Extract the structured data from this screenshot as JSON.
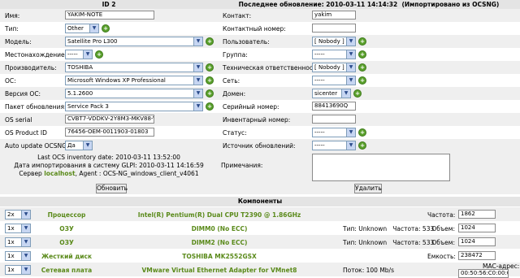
{
  "header": {
    "id_label": "ID 2",
    "last_update": "Последнее обновление: 2010-03-11 14:14:32",
    "imported": "(Импортировано из OCSNG)"
  },
  "left_fields": [
    {
      "label": "Имя:",
      "value": "YAKIM-NOTE",
      "kind": "input"
    },
    {
      "label": "Тип:",
      "value": "Other",
      "kind": "select",
      "plus": true
    },
    {
      "label": "Модель:",
      "value": "Satellite Pro L300",
      "kind": "select",
      "plus": true
    },
    {
      "label": "Местонахождение:",
      "value": "-----",
      "kind": "select",
      "plus": true
    },
    {
      "label": "Производитель:",
      "value": "TOSHIBA",
      "kind": "select",
      "plus": true
    },
    {
      "label": "ОС:",
      "value": "Microsoft Windows XP Professional",
      "kind": "select",
      "plus": true
    },
    {
      "label": "Версия ОС:",
      "value": "5.1.2600",
      "kind": "select",
      "plus": true
    },
    {
      "label": "Пакет обновления:",
      "value": "Service Pack 3",
      "kind": "select",
      "plus": true
    },
    {
      "label": "OS serial",
      "value": "CVBT7-VDDKV-2Y8M3-MKV88-V88B8",
      "kind": "input"
    },
    {
      "label": "OS Product ID",
      "value": "76456-OEM-0011903-01803",
      "kind": "input"
    },
    {
      "label": "Auto update OCSNG:",
      "value": "Да",
      "kind": "select"
    }
  ],
  "right_fields": [
    {
      "label": "Контакт:",
      "value": "yakim",
      "kind": "input"
    },
    {
      "label": "Контактный номер:",
      "value": "",
      "kind": "input"
    },
    {
      "label": "Пользователь:",
      "value": "[ Nobody ]",
      "kind": "select",
      "plus": true
    },
    {
      "label": "Группа:",
      "value": "-----",
      "kind": "select",
      "plus": true
    },
    {
      "label": "Техническая ответственность:",
      "value": "[ Nobody ]",
      "kind": "select",
      "plus": true
    },
    {
      "label": "Сеть:",
      "value": "-----",
      "kind": "select",
      "plus": true
    },
    {
      "label": "Домен:",
      "value": "sicenter",
      "kind": "select",
      "plus": true
    },
    {
      "label": "Серийный номер:",
      "value": "88413690Q",
      "kind": "input"
    },
    {
      "label": "Инвентарный номер:",
      "value": "",
      "kind": "input"
    },
    {
      "label": "Статус:",
      "value": "-----",
      "kind": "select",
      "plus": true
    },
    {
      "label": "Источник обновлений:",
      "value": "-----",
      "kind": "select",
      "plus": true
    }
  ],
  "info": {
    "inventory_date": "Last OCS inventory date: 2010-03-11 13:52:00",
    "glpi_import": "Дата импортирования в систему GLPI: 2010-03-11 14:16:59",
    "server_prefix": "Сервер",
    "server_name": "localhost",
    "agent": ", Agent : OCS-NG_windows_client_v4061"
  },
  "notes_label": "Примечания:",
  "buttons": {
    "update": "Обновить",
    "delete": "Удалить"
  },
  "components_title": "Компоненты",
  "components": [
    {
      "qty": "2x",
      "type": "Процессор",
      "name": "Intel(R) Pentium(R) Dual CPU T2390 @ 1.86GHz",
      "mid": "",
      "extra_label": "Частота:",
      "extra_value": "1862"
    },
    {
      "qty": "1x",
      "type": "ОЗУ",
      "name": "DIMM0 (No ECC)",
      "mid": "Тип: Unknown   Частота: 533",
      "extra_label": "Объем:",
      "extra_value": "1024"
    },
    {
      "qty": "1x",
      "type": "ОЗУ",
      "name": "DIMM2 (No ECC)",
      "mid": "Тип: Unknown   Частота: 533",
      "extra_label": "Объем:",
      "extra_value": "1024"
    },
    {
      "qty": "1x",
      "type": "Жесткий диск",
      "name": "TOSHIBA MK2552GSX",
      "mid": "",
      "extra_label": "Емкость:",
      "extra_value": "238472"
    },
    {
      "qty": "1x",
      "type": "Сетевая плата",
      "name": "VMware Virtual Ethernet Adapter for VMnet8",
      "mid": "Поток: 100 Mb/s",
      "extra_label": "MAC-адрес:",
      "extra_value": "00:50:56:C0:00:08"
    }
  ]
}
